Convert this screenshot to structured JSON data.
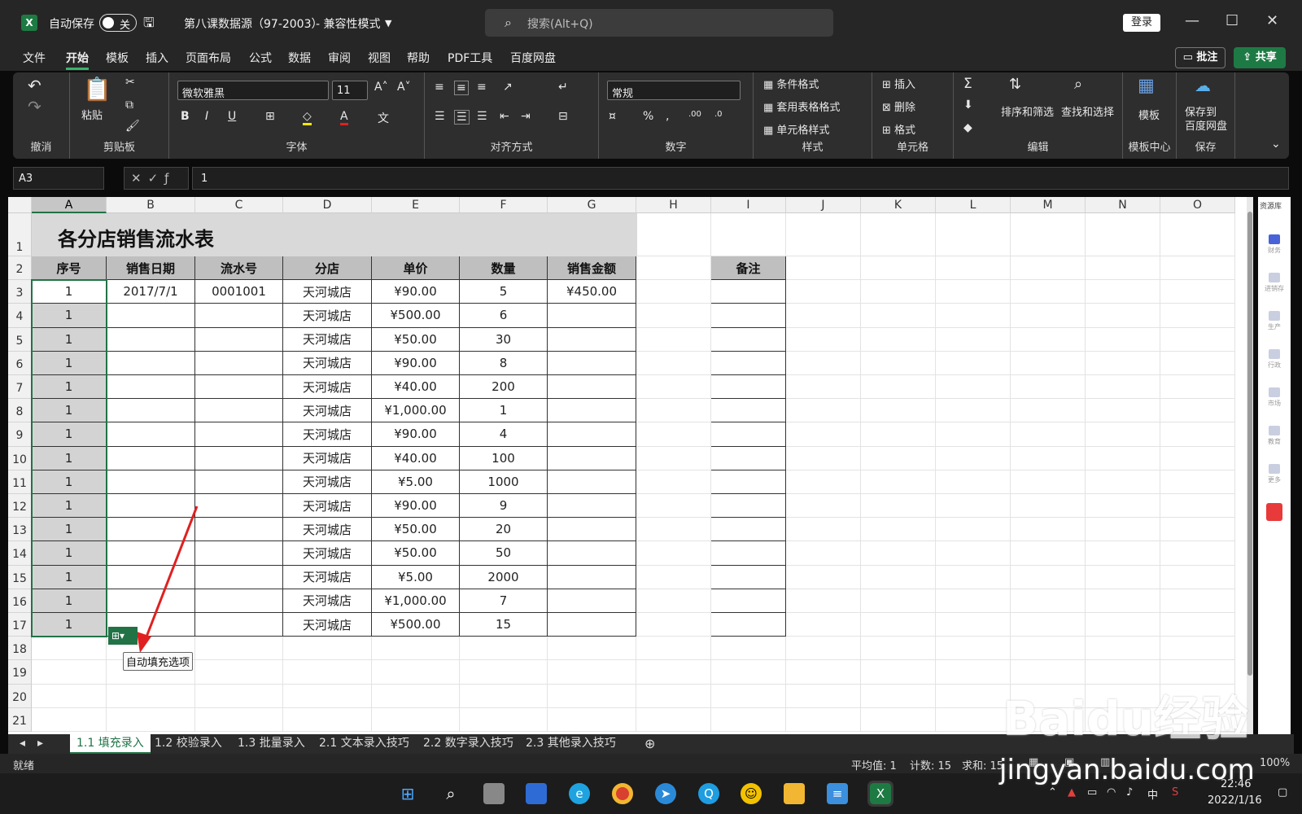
{
  "title_bar": {
    "autosave_label": "自动保存",
    "toggle_state": "关",
    "document_title": "第八课数据源（97-2003）",
    "mode": "- 兼容性模式",
    "search_placeholder": "搜索(Alt+Q)",
    "login_label": "登录"
  },
  "menu": {
    "items": [
      "文件",
      "开始",
      "模板",
      "插入",
      "页面布局",
      "公式",
      "数据",
      "审阅",
      "视图",
      "帮助",
      "PDF工具",
      "百度网盘"
    ],
    "active": "开始",
    "comment_label": "批注",
    "share_label": "共享"
  },
  "ribbon": {
    "groups": {
      "undo": "撤消",
      "clipboard": "剪贴板",
      "font": "字体",
      "alignment": "对齐方式",
      "number": "数字",
      "styles": "样式",
      "cells": "单元格",
      "editing": "编辑",
      "template_center": "模板中心",
      "save": "保存"
    },
    "paste_label": "粘贴",
    "font_name": "微软雅黑",
    "font_size": "11",
    "number_format": "常规",
    "conditional_format": "条件格式",
    "table_format": "套用表格格式",
    "cell_style": "单元格样式",
    "insert": "插入",
    "delete": "删除",
    "format": "格式",
    "sort_filter": "排序和筛选",
    "find_select": "查找和选择",
    "template": "模板",
    "save_to_line1": "保存到",
    "save_to_line2": "百度网盘"
  },
  "formula_bar": {
    "name_box": "A3",
    "formula": "1"
  },
  "sheet": {
    "columns": [
      "A",
      "B",
      "C",
      "D",
      "E",
      "F",
      "G",
      "H",
      "I",
      "J",
      "K",
      "L",
      "M",
      "N",
      "O"
    ],
    "title": "各分店销售流水表",
    "headers": [
      "序号",
      "销售日期",
      "流水号",
      "分店",
      "单价",
      "数量",
      "销售金额"
    ],
    "note_header": "备注",
    "rows": [
      [
        "1",
        "2017/7/1",
        "0001001",
        "天河城店",
        "¥90.00",
        "5",
        "¥450.00"
      ],
      [
        "1",
        "",
        "",
        "天河城店",
        "¥500.00",
        "6",
        ""
      ],
      [
        "1",
        "",
        "",
        "天河城店",
        "¥50.00",
        "30",
        ""
      ],
      [
        "1",
        "",
        "",
        "天河城店",
        "¥90.00",
        "8",
        ""
      ],
      [
        "1",
        "",
        "",
        "天河城店",
        "¥40.00",
        "200",
        ""
      ],
      [
        "1",
        "",
        "",
        "天河城店",
        "¥1,000.00",
        "1",
        ""
      ],
      [
        "1",
        "",
        "",
        "天河城店",
        "¥90.00",
        "4",
        ""
      ],
      [
        "1",
        "",
        "",
        "天河城店",
        "¥40.00",
        "100",
        ""
      ],
      [
        "1",
        "",
        "",
        "天河城店",
        "¥5.00",
        "1000",
        ""
      ],
      [
        "1",
        "",
        "",
        "天河城店",
        "¥90.00",
        "9",
        ""
      ],
      [
        "1",
        "",
        "",
        "天河城店",
        "¥50.00",
        "20",
        ""
      ],
      [
        "1",
        "",
        "",
        "天河城店",
        "¥50.00",
        "50",
        ""
      ],
      [
        "1",
        "",
        "",
        "天河城店",
        "¥5.00",
        "2000",
        ""
      ],
      [
        "1",
        "",
        "",
        "天河城店",
        "¥1,000.00",
        "7",
        ""
      ],
      [
        "1",
        "",
        "",
        "天河城店",
        "¥500.00",
        "15",
        ""
      ]
    ],
    "autofill_tooltip": "自动填充选项",
    "side_pane_title": "资源库",
    "side_pane_items": [
      "财务",
      "进销存",
      "生产",
      "行政",
      "市场",
      "教育",
      "更多"
    ]
  },
  "tabs": [
    "1.1 填充录入",
    "1.2 校验录入",
    "1.3 批量录入",
    "2.1 文本录入技巧",
    "2.2 数字录入技巧",
    "2.3 其他录入技巧"
  ],
  "status": {
    "ready": "就绪",
    "average": "平均值: 1",
    "count": "计数: 15",
    "sum": "求和: 15",
    "zoom": "100%"
  },
  "taskbar": {
    "time": "22:46",
    "date": "2022/1/16",
    "ime": "中"
  },
  "watermark": {
    "brand": "Baidu经验",
    "url": "jingyan.baidu.com"
  },
  "colors": {
    "excel_green": "#217346",
    "header_fill": "#bfbfbf",
    "title_fill": "#d9d9d9",
    "annotation_arrow": "#e02020"
  }
}
